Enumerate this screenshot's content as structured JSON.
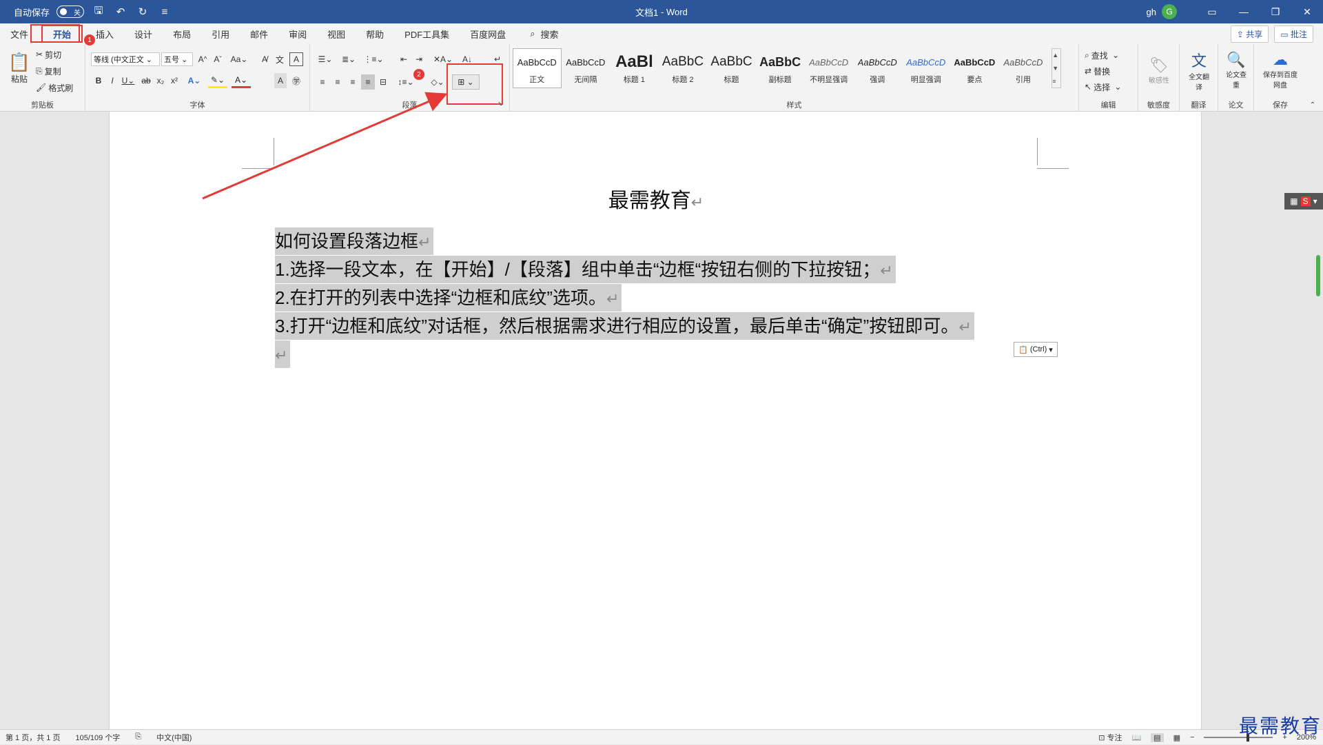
{
  "titlebar": {
    "autosave_label": "自动保存",
    "autosave_state": "关",
    "doc_name": "文档1",
    "separator": "-",
    "app_name": "Word",
    "user_initials": "gh",
    "avatar_letter": "G"
  },
  "tabs": [
    "文件",
    "开始",
    "插入",
    "设计",
    "布局",
    "引用",
    "邮件",
    "审阅",
    "视图",
    "帮助",
    "PDF工具集",
    "百度网盘"
  ],
  "search_label": "搜索",
  "share_label": "共享",
  "comments_label": "批注",
  "clipboard": {
    "paste": "粘贴",
    "cut": "剪切",
    "copy": "复制",
    "format_painter": "格式刷",
    "group": "剪贴板"
  },
  "font": {
    "name": "等线 (中文正文",
    "size": "五号",
    "group": "字体"
  },
  "paragraph": {
    "group": "段落"
  },
  "styles": {
    "group": "样式",
    "items": [
      {
        "sample": "AaBbCcD",
        "name": "正文"
      },
      {
        "sample": "AaBbCcD",
        "name": "无间隔"
      },
      {
        "sample": "AaBl",
        "name": "标题 1"
      },
      {
        "sample": "AaBbC",
        "name": "标题 2"
      },
      {
        "sample": "AaBbC",
        "name": "标题"
      },
      {
        "sample": "AaBbC",
        "name": "副标题"
      },
      {
        "sample": "AaBbCcD",
        "name": "不明显强调"
      },
      {
        "sample": "AaBbCcD",
        "name": "强调"
      },
      {
        "sample": "AaBbCcD",
        "name": "明显强调"
      },
      {
        "sample": "AaBbCcD",
        "name": "要点"
      },
      {
        "sample": "AaBbCcD",
        "name": "引用"
      }
    ]
  },
  "editing": {
    "find": "查找",
    "replace": "替换",
    "select": "选择",
    "group": "编辑"
  },
  "sensitivity": {
    "label": "敏感性",
    "group": "敏感度"
  },
  "translate": {
    "label": "全文翻译",
    "group": "翻译"
  },
  "paper": {
    "label": "论文查重",
    "group": "论文"
  },
  "save": {
    "label": "保存到百度网盘",
    "group": "保存"
  },
  "document": {
    "title": "最需教育",
    "lines": [
      "如何设置段落边框",
      "1.选择一段文本，在【开始】/【段落】组中单击“边框“按钮右侧的下拉按钮；",
      "2.在打开的列表中选择“边框和底纹”选项。",
      "3.打开“边框和底纹”对话框，然后根据需求进行相应的设置，最后单击“确定”按钮即可。"
    ],
    "paragraph_mark": "↵",
    "ctrl_label": "(Ctrl)"
  },
  "status": {
    "page": "第 1 页，共 1 页",
    "words": "105/109 个字",
    "language": "中文(中国)",
    "focus": "专注",
    "zoom": "200%"
  },
  "annotations": {
    "step1": "1",
    "step2": "2"
  },
  "watermark": "最需教育",
  "colors": {
    "brand": "#2b579a",
    "annotation": "#e53935"
  }
}
